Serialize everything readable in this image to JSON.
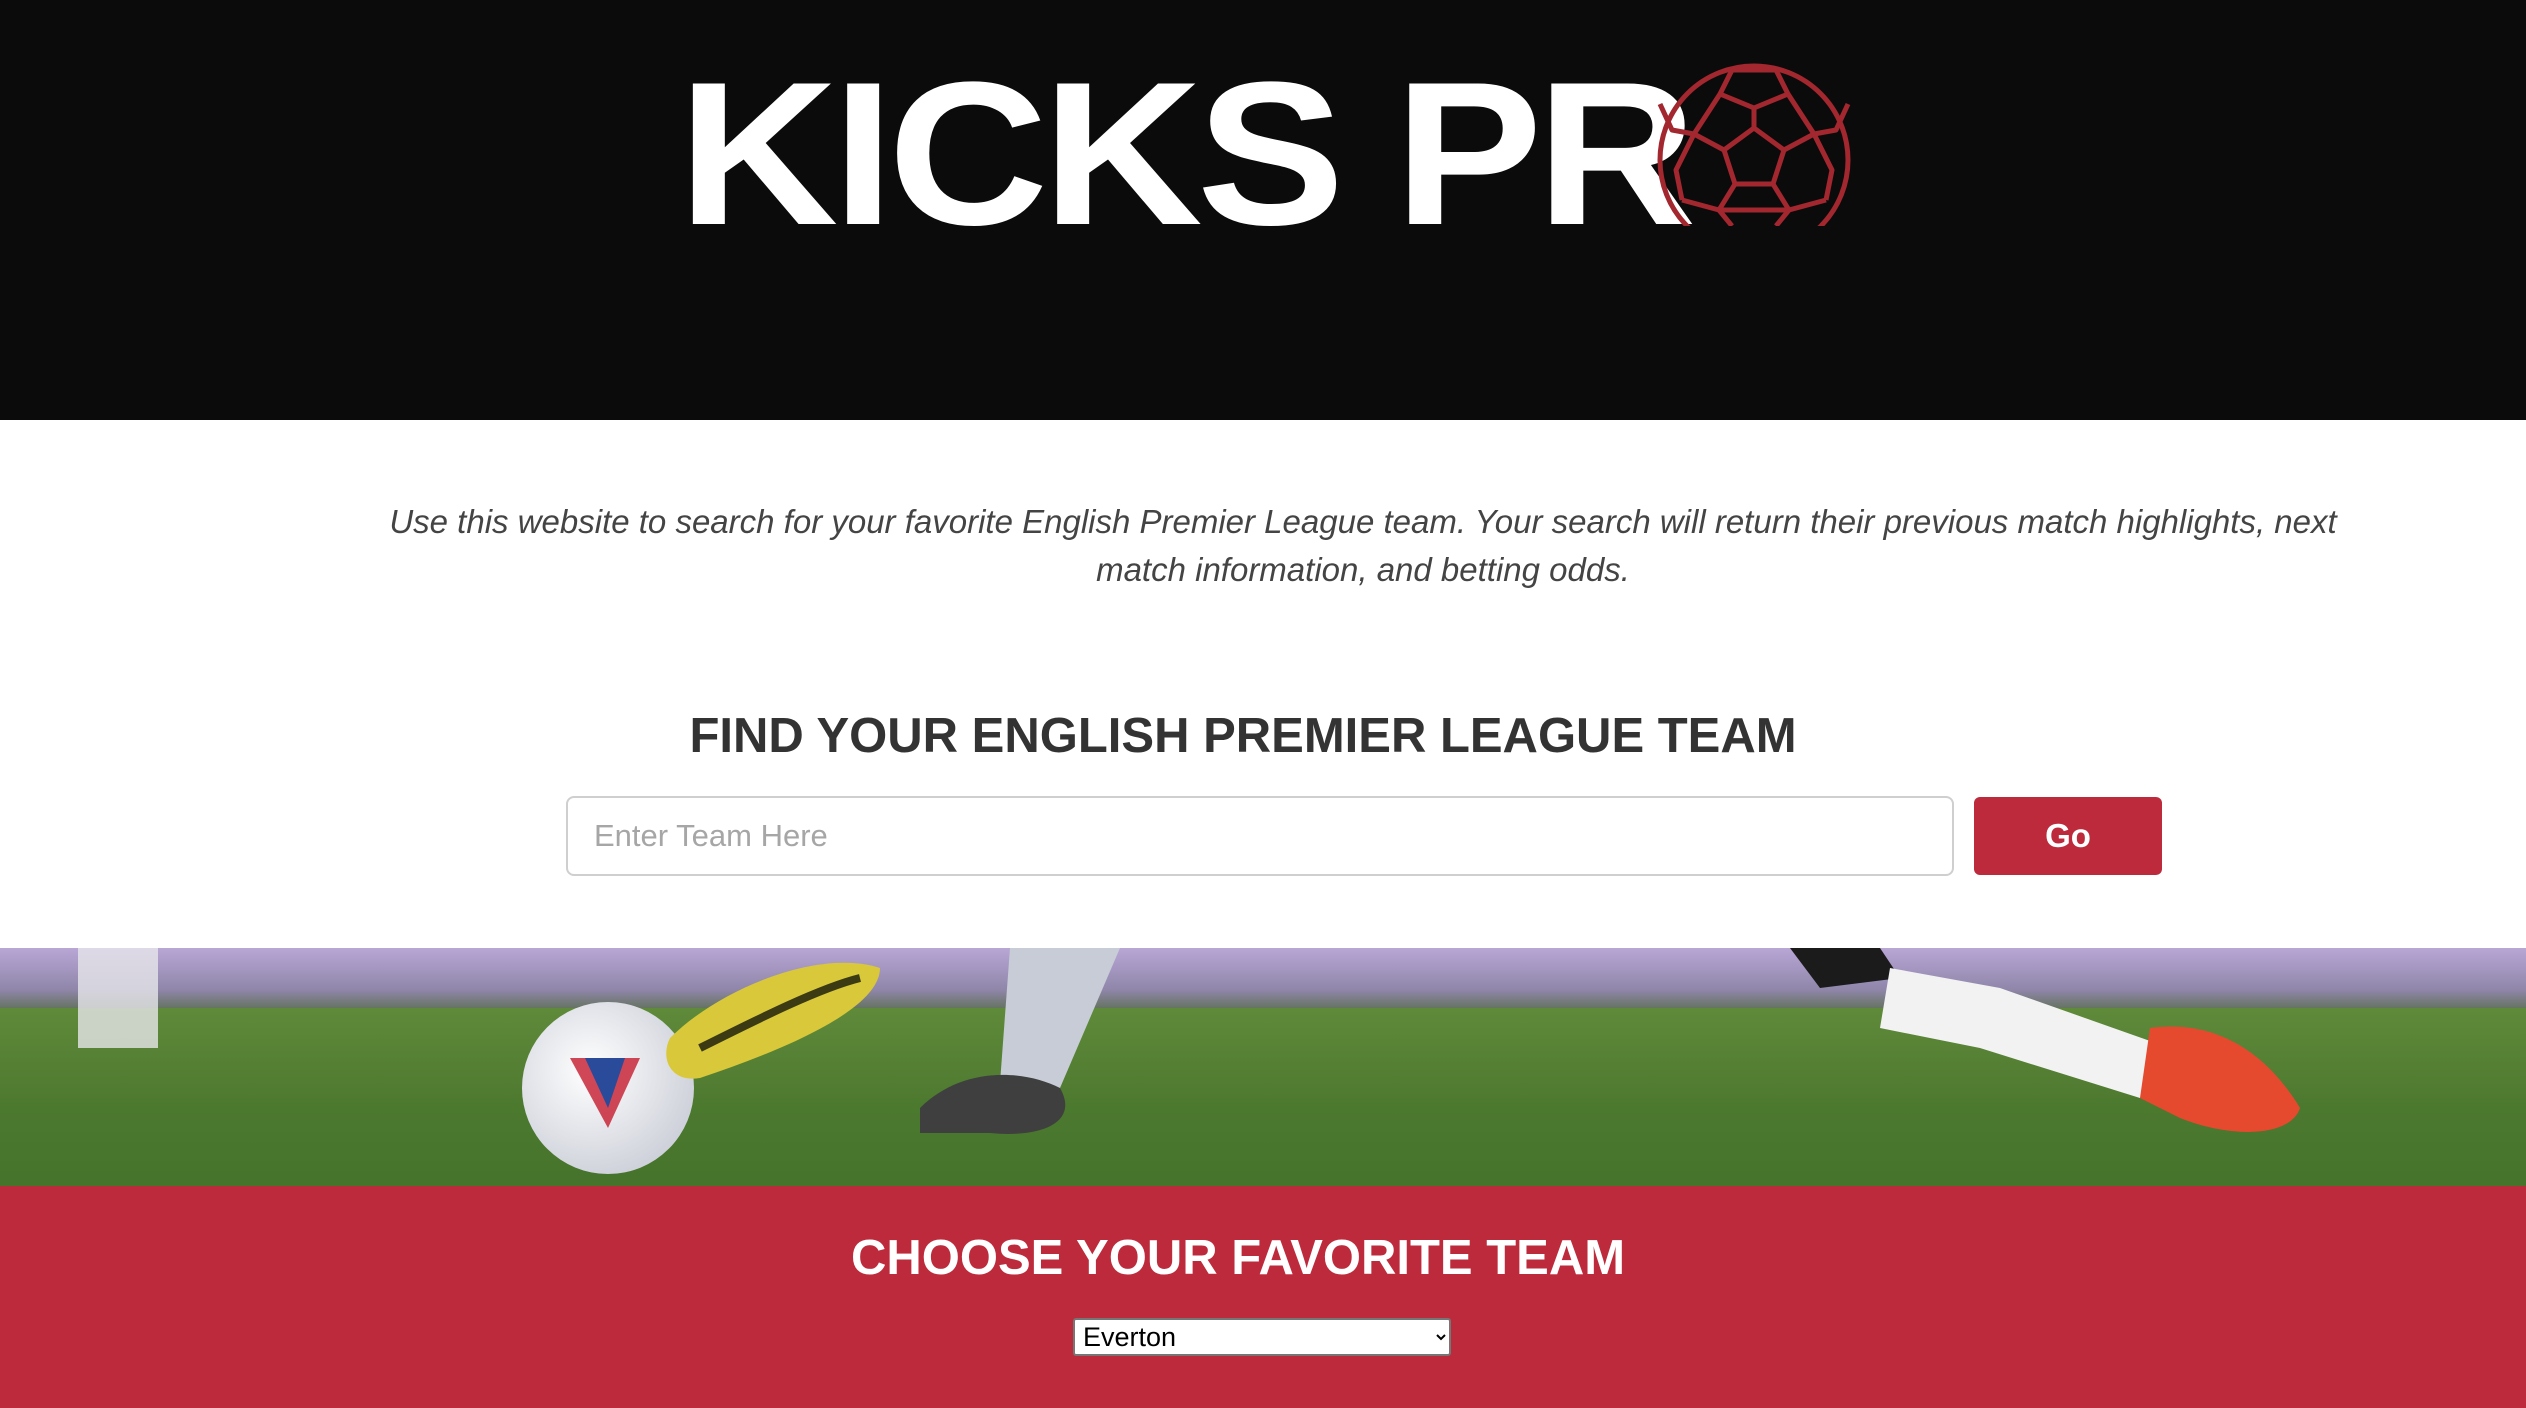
{
  "header": {
    "logo_text": "KICKS PR",
    "logo_ball_icon": "soccer-ball-icon",
    "colors": {
      "background": "#0b0b0b",
      "logo_text": "#ffffff",
      "ball": "#a2272e"
    }
  },
  "intro": {
    "text": "Use this website to search for your favorite English Premier League team. Your search will return their previous match highlights, next match information, and betting odds."
  },
  "search": {
    "title": "FIND YOUR ENGLISH PREMIER LEAGUE TEAM",
    "placeholder": "Enter Team Here",
    "value": "",
    "button_label": "Go"
  },
  "favorite": {
    "title": "CHOOSE YOUR FAVORITE TEAM",
    "selected": "Everton"
  },
  "colors": {
    "accent": "#bd2a3c"
  }
}
